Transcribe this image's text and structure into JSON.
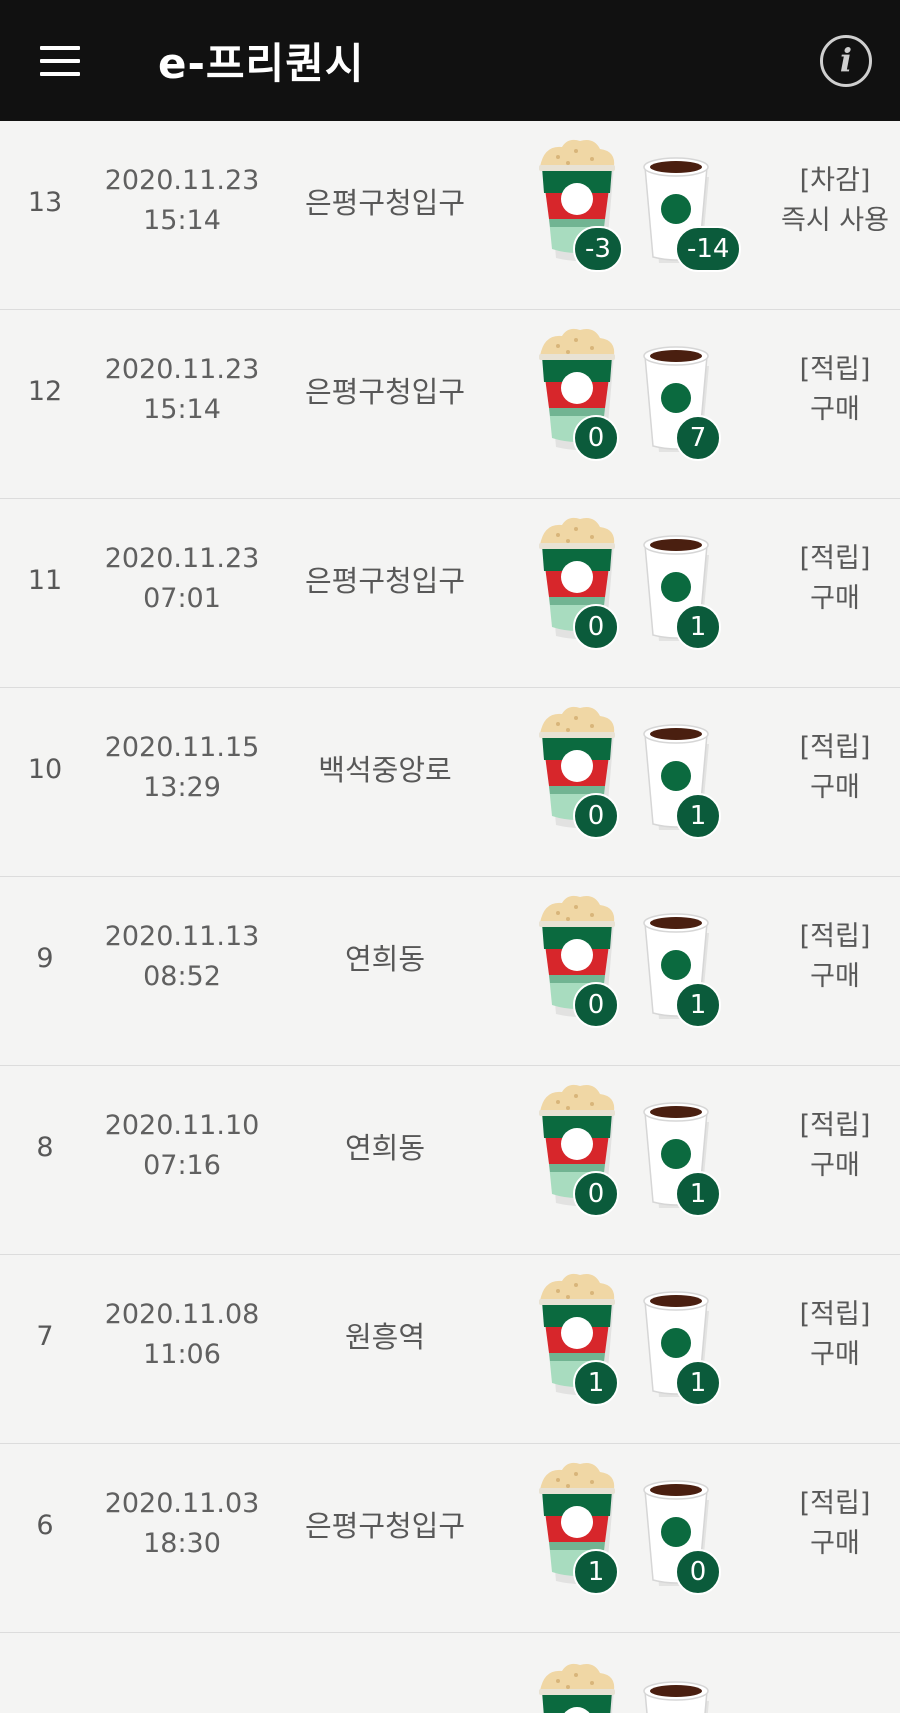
{
  "header": {
    "title": "e-프리퀀시",
    "menu_icon": "hamburger-menu-icon",
    "info_icon": "info-icon",
    "info_glyph": "i"
  },
  "colors": {
    "header_bg": "#111111",
    "page_bg": "#f4f4f3",
    "badge_green": "#0b5b3b",
    "cup_red": "#d7262b",
    "cup_green": "#0b6a3f",
    "cup_mint": "#a8dcbf",
    "whipped_cream": "#f0d7a5"
  },
  "rows": [
    {
      "no": "13",
      "date": "2020.11.23",
      "time": "15:14",
      "store": "은평구청입구",
      "frap_count": "-3",
      "coffee_count": "-14",
      "type": "[차감]",
      "desc": "즉시 사용"
    },
    {
      "no": "12",
      "date": "2020.11.23",
      "time": "15:14",
      "store": "은평구청입구",
      "frap_count": "0",
      "coffee_count": "7",
      "type": "[적립]",
      "desc": "구매"
    },
    {
      "no": "11",
      "date": "2020.11.23",
      "time": "07:01",
      "store": "은평구청입구",
      "frap_count": "0",
      "coffee_count": "1",
      "type": "[적립]",
      "desc": "구매"
    },
    {
      "no": "10",
      "date": "2020.11.15",
      "time": "13:29",
      "store": "백석중앙로",
      "frap_count": "0",
      "coffee_count": "1",
      "type": "[적립]",
      "desc": "구매"
    },
    {
      "no": "9",
      "date": "2020.11.13",
      "time": "08:52",
      "store": "연희동",
      "frap_count": "0",
      "coffee_count": "1",
      "type": "[적립]",
      "desc": "구매"
    },
    {
      "no": "8",
      "date": "2020.11.10",
      "time": "07:16",
      "store": "연희동",
      "frap_count": "0",
      "coffee_count": "1",
      "type": "[적립]",
      "desc": "구매"
    },
    {
      "no": "7",
      "date": "2020.11.08",
      "time": "11:06",
      "store": "원흥역",
      "frap_count": "1",
      "coffee_count": "1",
      "type": "[적립]",
      "desc": "구매"
    },
    {
      "no": "6",
      "date": "2020.11.03",
      "time": "18:30",
      "store": "은평구청입구",
      "frap_count": "1",
      "coffee_count": "0",
      "type": "[적립]",
      "desc": "구매"
    }
  ]
}
